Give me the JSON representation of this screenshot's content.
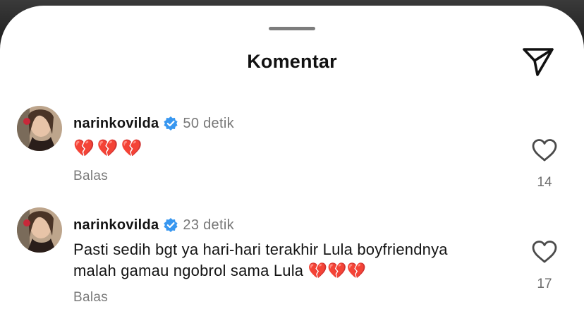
{
  "header": {
    "title": "Komentar",
    "share_icon": "paper-plane-icon"
  },
  "comments": [
    {
      "username": "narinkovilda",
      "verified": true,
      "time": "50 detik",
      "text": "💔💔💔",
      "reply_label": "Balas",
      "likes": "14"
    },
    {
      "username": "narinkovilda",
      "verified": true,
      "time": "23 detik",
      "text_line1": "Pasti sedih bgt ya hari-hari terakhir Lula boyfriendnya",
      "text_line2": "malah gamau ngobrol sama Lula 💔💔💔",
      "reply_label": "Balas",
      "likes": "17"
    }
  ],
  "colors": {
    "verified_badge": "#3897f0",
    "heartbreak": "#d4223a",
    "secondary_text": "#777777"
  }
}
